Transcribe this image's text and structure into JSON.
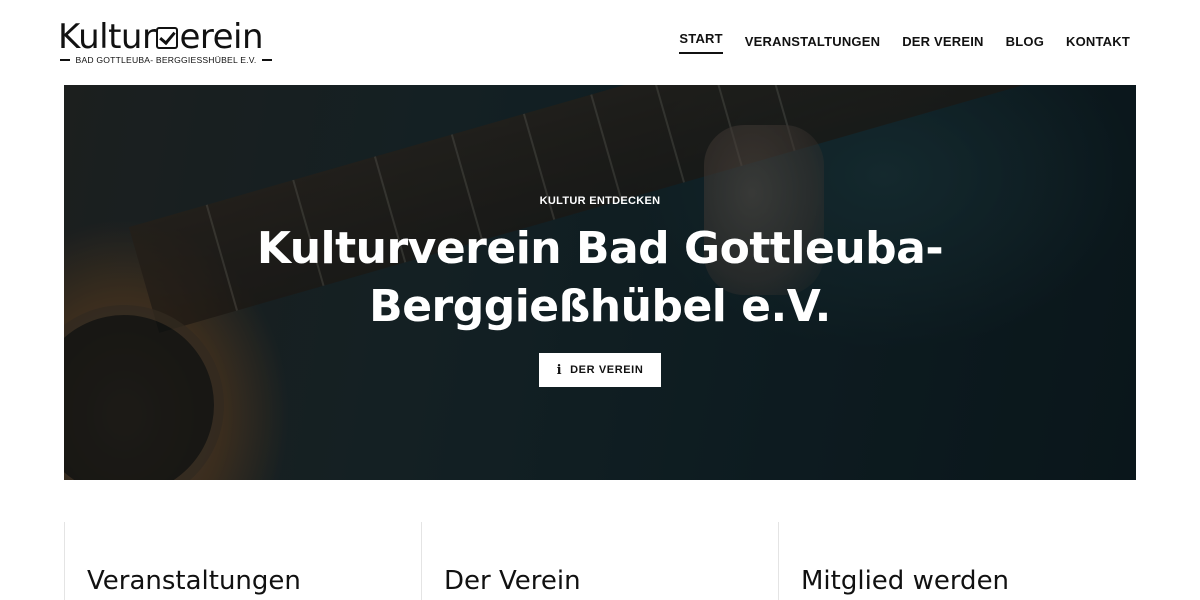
{
  "logo": {
    "word_before": "Kultur",
    "word_after": "erein",
    "check_icon": "checkbox-check-icon",
    "subtitle": "BAD GOTTLEUBA- BERGGIESSHÜBEL E.V."
  },
  "nav": {
    "items": [
      {
        "label": "START",
        "active": true
      },
      {
        "label": "VERANSTALTUNGEN",
        "active": false
      },
      {
        "label": "DER VEREIN",
        "active": false
      },
      {
        "label": "BLOG",
        "active": false
      },
      {
        "label": "KONTAKT",
        "active": false
      }
    ]
  },
  "hero": {
    "eyebrow": "KULTUR ENTDECKEN",
    "title_line1": "Kulturverein Bad Gottleuba-",
    "title_line2": "Berggießhübel e.V.",
    "button_icon": "info-icon",
    "button_label": "DER VEREIN"
  },
  "cards": [
    {
      "title": "Veranstaltungen"
    },
    {
      "title": "Der Verein"
    },
    {
      "title": "Mitglied werden"
    }
  ]
}
